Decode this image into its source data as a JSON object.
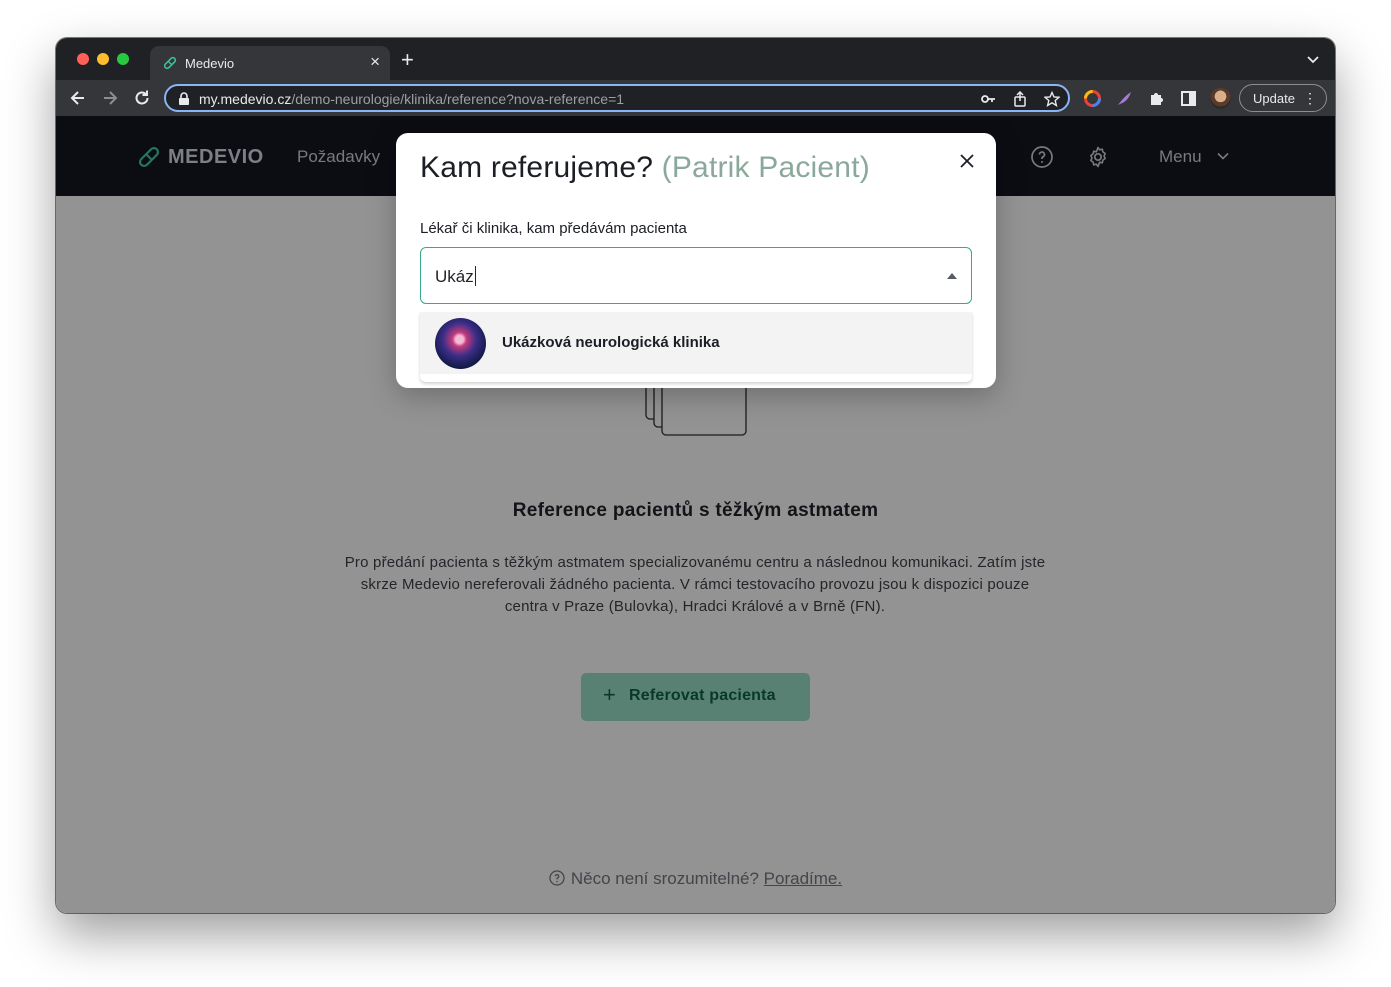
{
  "browser": {
    "tab_title": "Medevio",
    "url_host": "my.medevio.cz",
    "url_path": "/demo-neurologie/klinika/reference?nova-reference=1",
    "update_label": "Update"
  },
  "app": {
    "logo_text": "MEDEVIO",
    "nav_requests": "Požadavky",
    "nav_menu": "Menu"
  },
  "page": {
    "empty_title": "Reference pacientů s těžkým astmatem",
    "empty_desc": "Pro předání pacienta s těžkým astmatem specializovanému centru a následnou komunikaci. Zatím jste skrze Medevio nereferovali žádného pacienta. V rámci testovacího provozu jsou k dispozici pouze centra v Praze (Bulovka), Hradci Králové a v Brně (FN).",
    "cta_label": "Referovat pacienta",
    "help_text": "Něco není srozumitelné?",
    "help_link": "Poradíme."
  },
  "modal": {
    "title": "Kam referujeme?",
    "patient": "(Patrik Pacient)",
    "field_label": "Lékař či klinika, kam předávám pacienta",
    "field_value": "Ukáz",
    "options": [
      {
        "label": "Ukázková neurologická klinika"
      }
    ]
  },
  "colors": {
    "accent": "#38a88a",
    "nav_bg": "#12151f",
    "cta_bg": "#8fd1bc"
  }
}
